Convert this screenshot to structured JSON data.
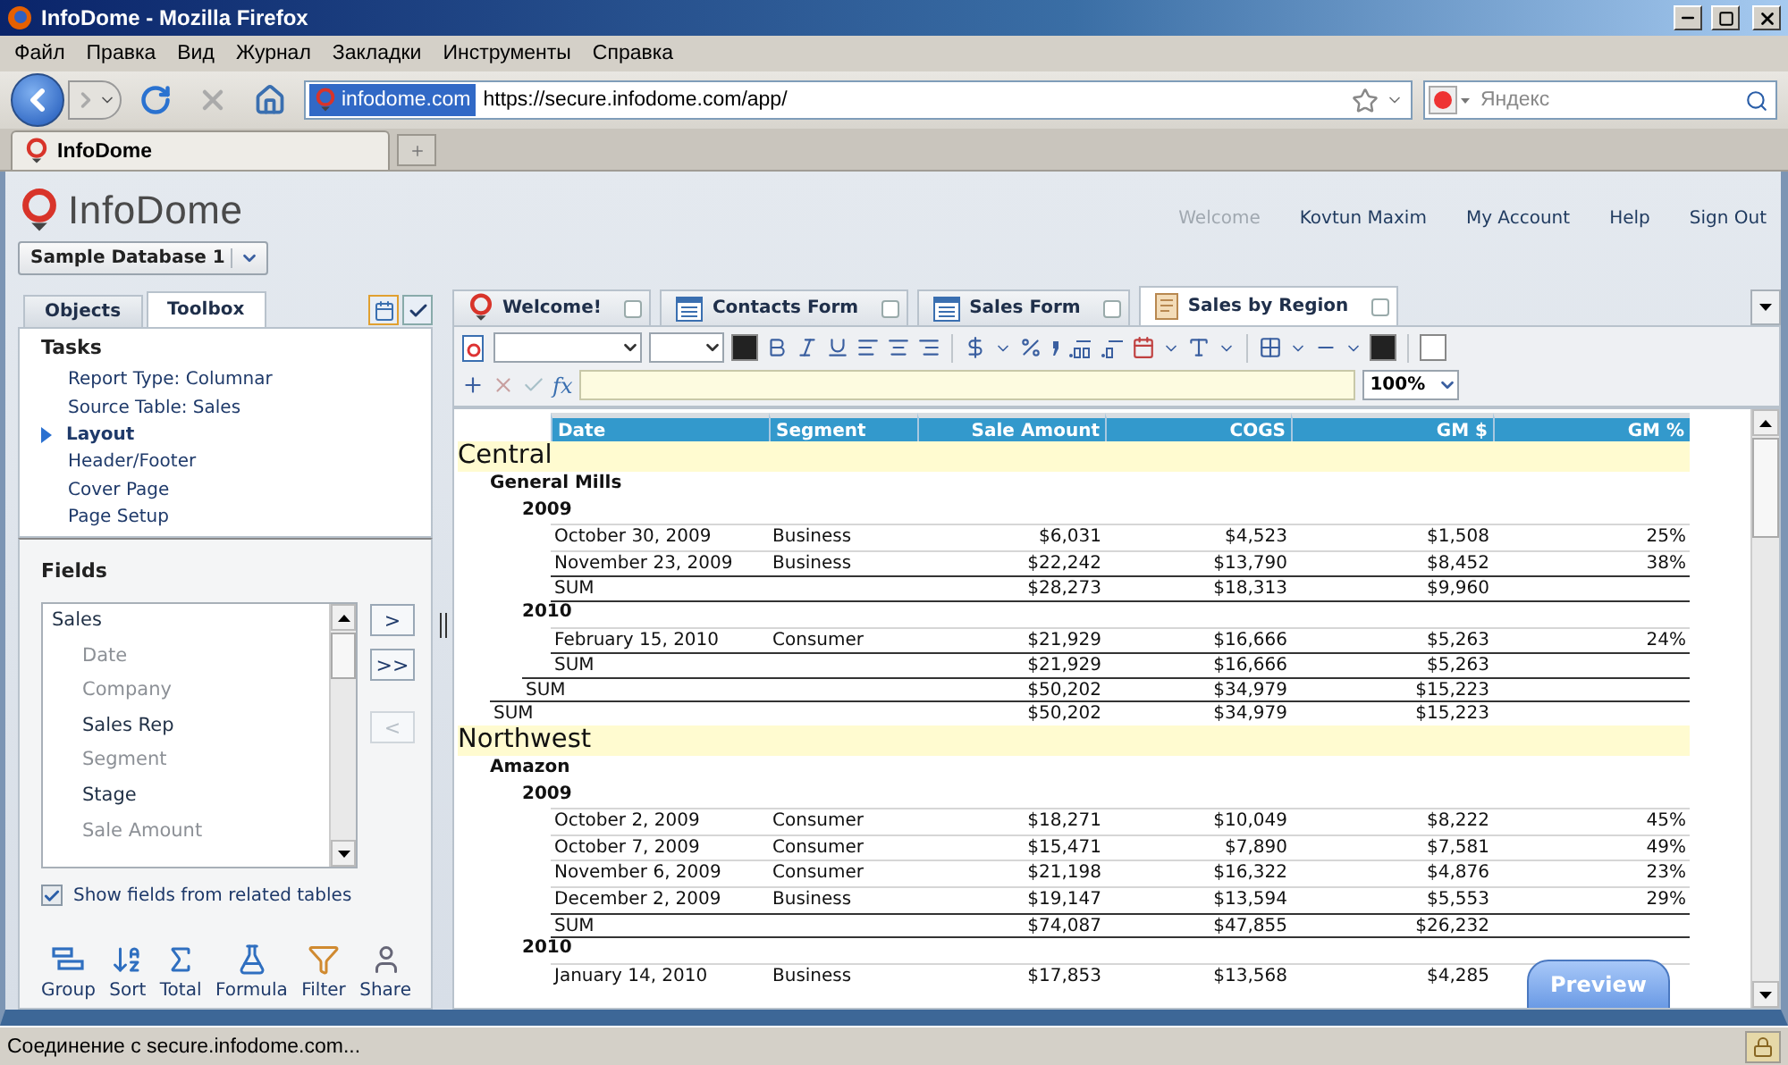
{
  "browser": {
    "title": "InfoDome - Mozilla Firefox",
    "menu": [
      "Файл",
      "Правка",
      "Вид",
      "Журнал",
      "Закладки",
      "Инструменты",
      "Справка"
    ],
    "site_badge": "infodome.com",
    "url": "https://secure.infodome.com/app/",
    "search": {
      "placeholder": "Яндекс"
    },
    "tabs": [
      {
        "label": "InfoDome",
        "selected": true
      }
    ],
    "status": "Соединение с secure.infodome.com..."
  },
  "app": {
    "logo": "InfoDome",
    "welcome": "Welcome",
    "user": "Kovtun Maxim",
    "links": [
      "My Account",
      "Help",
      "Sign Out"
    ],
    "database": "Sample Database 1",
    "panel_tabs": [
      {
        "label": "Objects",
        "selected": false
      },
      {
        "label": "Toolbox",
        "selected": true
      }
    ],
    "tasks": {
      "title": "Tasks",
      "items": [
        {
          "label": "Report Type: Columnar",
          "selected": false
        },
        {
          "label": "Source Table: Sales",
          "selected": false
        },
        {
          "label": "Layout",
          "selected": true
        },
        {
          "label": "Header/Footer",
          "selected": false
        },
        {
          "label": "Cover Page",
          "selected": false
        },
        {
          "label": "Page Setup",
          "selected": false
        }
      ]
    },
    "fields": {
      "title": "Fields",
      "table": "Sales",
      "items": [
        {
          "label": "Date",
          "in_report": true
        },
        {
          "label": "Company",
          "in_report": true
        },
        {
          "label": "Sales Rep",
          "in_report": false
        },
        {
          "label": "Segment",
          "in_report": true
        },
        {
          "label": "Stage",
          "in_report": false
        },
        {
          "label": "Sale Amount",
          "in_report": true
        }
      ],
      "buttons": [
        {
          "label": ">",
          "disabled": false
        },
        {
          "label": ">>",
          "disabled": false
        },
        {
          "label": "<",
          "disabled": true
        }
      ],
      "related": {
        "label": "Show fields from related tables",
        "checked": true
      }
    },
    "tools": [
      {
        "label": "Group",
        "kind": "group"
      },
      {
        "label": "Sort",
        "kind": "sort"
      },
      {
        "label": "Total",
        "kind": "total"
      },
      {
        "label": "Formula",
        "kind": "formula"
      },
      {
        "label": "Filter",
        "kind": "filter"
      },
      {
        "label": "Share",
        "kind": "share"
      }
    ],
    "doc_tabs": [
      {
        "label": "Welcome!",
        "kind": "home",
        "selected": false
      },
      {
        "label": "Contacts Form",
        "kind": "form",
        "selected": false
      },
      {
        "label": "Sales Form",
        "kind": "form",
        "selected": false
      },
      {
        "label": "Sales by Region",
        "kind": "report",
        "selected": true
      }
    ],
    "formula": {
      "fx": "fx",
      "zoom": "100%"
    },
    "report": {
      "columns": [
        "Date",
        "Segment",
        "Sale Amount",
        "COGS",
        "GM $",
        "GM %"
      ],
      "rows": [
        {
          "kind": "region",
          "label": "Central"
        },
        {
          "kind": "company",
          "label": "General Mills"
        },
        {
          "kind": "year",
          "label": "2009"
        },
        {
          "kind": "detail",
          "cells": [
            "October 30, 2009",
            "Business",
            "$6,031",
            "$4,523",
            "$1,508",
            "25%"
          ]
        },
        {
          "kind": "detail",
          "cells": [
            "November 23, 2009",
            "Business",
            "$22,242",
            "$13,790",
            "$8,452",
            "38%"
          ]
        },
        {
          "kind": "sum_year",
          "label": "SUM",
          "values": [
            "$28,273",
            "$18,313",
            "$9,960"
          ]
        },
        {
          "kind": "year",
          "label": "2010"
        },
        {
          "kind": "detail",
          "cells": [
            "February 15, 2010",
            "Consumer",
            "$21,929",
            "$16,666",
            "$5,263",
            "24%"
          ]
        },
        {
          "kind": "sum_year",
          "label": "SUM",
          "values": [
            "$21,929",
            "$16,666",
            "$5,263"
          ]
        },
        {
          "kind": "sum_company",
          "label": "SUM",
          "values": [
            "$50,202",
            "$34,979",
            "$15,223"
          ]
        },
        {
          "kind": "sum_region",
          "label": "SUM",
          "values": [
            "$50,202",
            "$34,979",
            "$15,223"
          ]
        },
        {
          "kind": "region",
          "label": "Northwest"
        },
        {
          "kind": "company",
          "label": "Amazon"
        },
        {
          "kind": "year",
          "label": "2009"
        },
        {
          "kind": "detail",
          "cells": [
            "October 2, 2009",
            "Consumer",
            "$18,271",
            "$10,049",
            "$8,222",
            "45%"
          ]
        },
        {
          "kind": "detail",
          "cells": [
            "October 7, 2009",
            "Consumer",
            "$15,471",
            "$7,890",
            "$7,581",
            "49%"
          ]
        },
        {
          "kind": "detail",
          "cells": [
            "November 6, 2009",
            "Consumer",
            "$21,198",
            "$16,322",
            "$4,876",
            "23%"
          ]
        },
        {
          "kind": "detail",
          "cells": [
            "December 2, 2009",
            "Business",
            "$19,147",
            "$13,594",
            "$5,553",
            "29%"
          ]
        },
        {
          "kind": "sum_year",
          "label": "SUM",
          "values": [
            "$74,087",
            "$47,855",
            "$26,232"
          ]
        },
        {
          "kind": "year",
          "label": "2010"
        },
        {
          "kind": "detail",
          "cells": [
            "January 14, 2010",
            "Business",
            "$17,853",
            "$13,568",
            "$4,285"
          ]
        }
      ]
    },
    "preview": "Preview"
  }
}
